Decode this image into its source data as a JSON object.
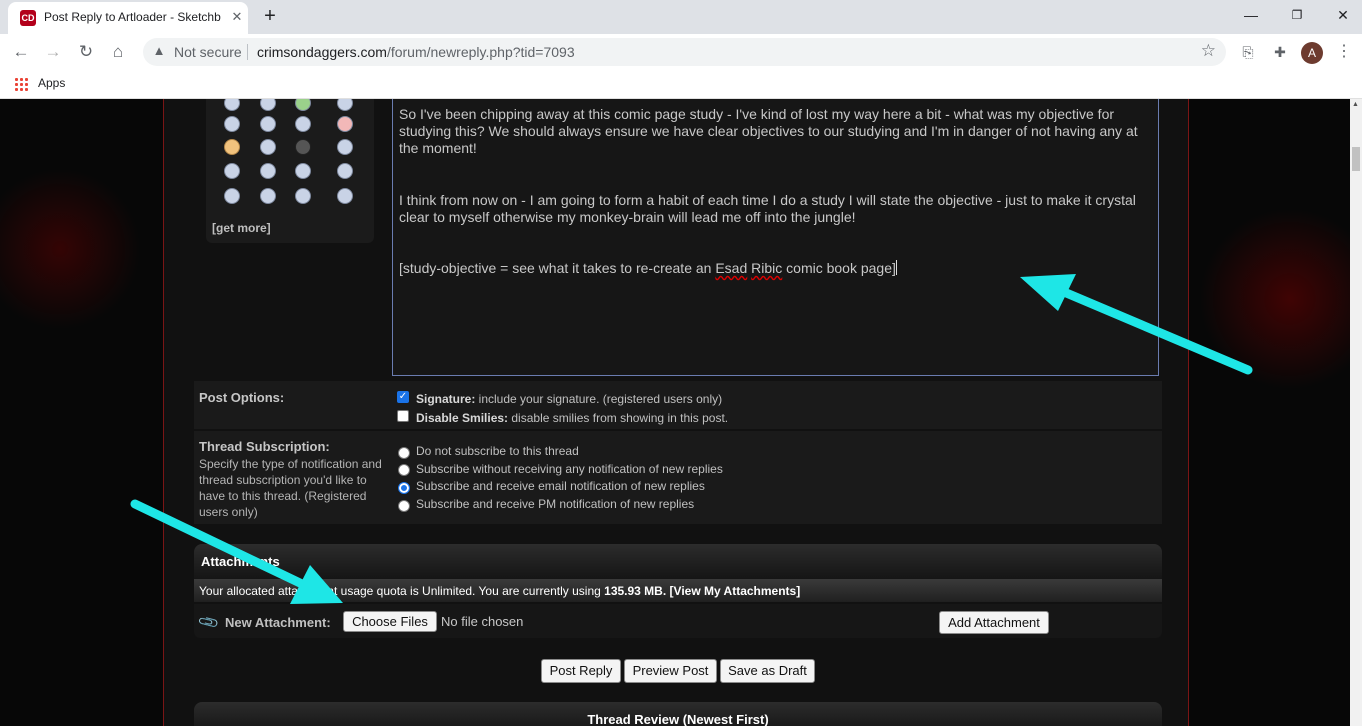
{
  "browser": {
    "tab_title": "Post Reply to Artloader - Sketchb",
    "tab_favicon_text": "CD",
    "new_tab_symbol": "+",
    "security_label": "Not secure",
    "url_host": "crimsondaggers.com",
    "url_path": "/forum/newreply.php?tid=7093",
    "bookmarks": {
      "apps_label": "Apps"
    },
    "avatar_letter": "A",
    "accent_color": "#1a73e8"
  },
  "smilies": {
    "count_visible": 20,
    "get_more_label": "[get more]"
  },
  "editor": {
    "paragraphs": [
      "So I've been chipping away at this comic page study - I've kind of lost my way here a bit - what was my objective for studying this?  We should always ensure we have clear objectives to our studying and I'm in danger of not having any at the moment!",
      "I think from now on - I am going to form a habit of each time I do a study I will state the objective - just to make it crystal clear to myself otherwise my monkey-brain will lead me off into the jungle!"
    ],
    "last_line_before": "[study-objective = see what it takes to re-create an ",
    "misspelled_1": "Esad",
    "space": " ",
    "misspelled_2": "Ribic",
    "last_line_after": " comic book page]"
  },
  "post_options": {
    "label": "Post Options:",
    "signature": {
      "checked": true,
      "bold": "Signature:",
      "text": " include your signature. (registered users only)"
    },
    "disable_smilies": {
      "checked": false,
      "bold": "Disable Smilies:",
      "text": " disable smilies from showing in this post."
    }
  },
  "thread_subscription": {
    "label": "Thread Subscription:",
    "description": "Specify the type of notification and thread subscription you'd like to have to this thread. (Registered users only)",
    "options": [
      {
        "label": "Do not subscribe to this thread",
        "selected": false
      },
      {
        "label": "Subscribe without receiving any notification of new replies",
        "selected": false
      },
      {
        "label": "Subscribe and receive email notification of new replies",
        "selected": true
      },
      {
        "label": "Subscribe and receive PM notification of new replies",
        "selected": false
      }
    ]
  },
  "attachments": {
    "title": "Attachments",
    "quota_prefix": "Your allocated attachment usage quota is Unlimited. You are currently using ",
    "quota_used": "135.93 MB.",
    "view_link": "[View My Attachments]",
    "new_attachment_label": "New Attachment:",
    "choose_files": "Choose Files",
    "no_file": "No file chosen",
    "add_attachment": "Add Attachment"
  },
  "actions": {
    "post_reply": "Post Reply",
    "preview_post": "Preview Post",
    "save_draft": "Save as Draft"
  },
  "thread_review": {
    "title": "Thread Review (Newest First)"
  },
  "annotation_color": "#1ee6e6"
}
